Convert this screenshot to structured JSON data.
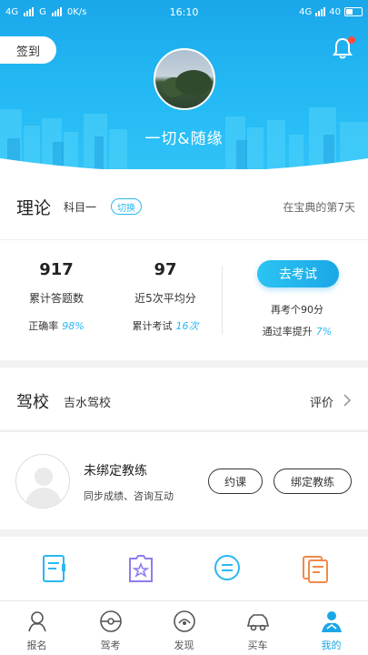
{
  "status_bar": {
    "network_left": "4G",
    "network_mid": "G",
    "speed": "0K/s",
    "time": "16:10",
    "network_right": "4G",
    "battery": "40"
  },
  "header": {
    "checkin_label": "签到",
    "nickname": "一切&随缘"
  },
  "theory": {
    "title": "理论",
    "subject": "科目一",
    "switch_label": "切换",
    "days_text": "在宝典的第7天",
    "stats": {
      "questions_count": "917",
      "questions_label": "累计答题数",
      "accuracy_label": "正确率",
      "accuracy_value": "98%",
      "avg_score": "97",
      "avg_label": "近5次平均分",
      "exam_count_label": "累计考试",
      "exam_count_value": "16次"
    },
    "exam_button": "去考试",
    "exam_note1": "再考个90分",
    "exam_note2_label": "通过率提升",
    "exam_note2_value": "7%"
  },
  "school": {
    "title": "驾校",
    "name": "吉水驾校",
    "eval_label": "评价"
  },
  "coach": {
    "name": "未绑定教练",
    "desc": "同步成绩、咨询互动",
    "book_button": "约课",
    "bind_button": "绑定教练"
  },
  "tabs": [
    {
      "label": "报名"
    },
    {
      "label": "驾考"
    },
    {
      "label": "发现"
    },
    {
      "label": "买车"
    },
    {
      "label": "我的"
    }
  ],
  "colors": {
    "accent": "#1ba7e6",
    "header_blue": "#22b7f3",
    "badge_red": "#ff4b3a"
  }
}
